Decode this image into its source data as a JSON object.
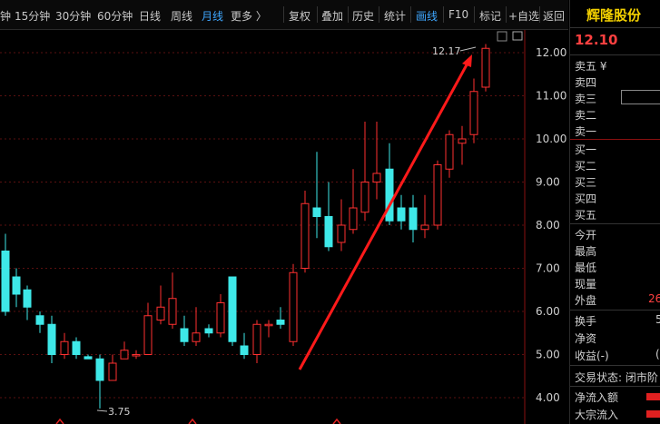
{
  "toolbar": {
    "periods": [
      "钟",
      "15分钟",
      "30分钟",
      "60分钟",
      "日线",
      "周线",
      "月线",
      "更多 〉"
    ],
    "active_period": "月线",
    "tools": [
      "复权",
      "叠加",
      "历史",
      "统计",
      "画线",
      "F10",
      "标记",
      "+自选",
      "返回"
    ],
    "active_tool": "画线"
  },
  "chart": {
    "y_ticks": [
      "12.00",
      "11.00",
      "10.00",
      "9.00",
      "8.00",
      "7.00",
      "6.00",
      "5.00",
      "4.00"
    ],
    "high_label": "12.17",
    "low_label": "3.75",
    "colors": {
      "up": "#ff3030",
      "down": "#3ee8e8",
      "trend": "#ff1a1a"
    }
  },
  "quote": {
    "name": "辉隆股份",
    "price": "12.10",
    "order_book": [
      "卖五 ¥",
      "卖四",
      "卖三",
      "卖二",
      "卖一",
      "买一",
      "买二",
      "买三",
      "买四",
      "买五"
    ],
    "stats": [
      {
        "label": "今开",
        "value": ""
      },
      {
        "label": "最高",
        "value": ""
      },
      {
        "label": "最低",
        "value": ""
      },
      {
        "label": "现量",
        "value": ""
      },
      {
        "label": "外盘",
        "value": "26"
      }
    ],
    "stats2": [
      {
        "label": "换手",
        "value": "5"
      },
      {
        "label": "净资",
        "value": ""
      },
      {
        "label": "收益(-)",
        "value": "("
      }
    ],
    "trade_status": "交易状态: 闭市阶",
    "flows": [
      "净流入额",
      "大宗流入"
    ]
  }
}
